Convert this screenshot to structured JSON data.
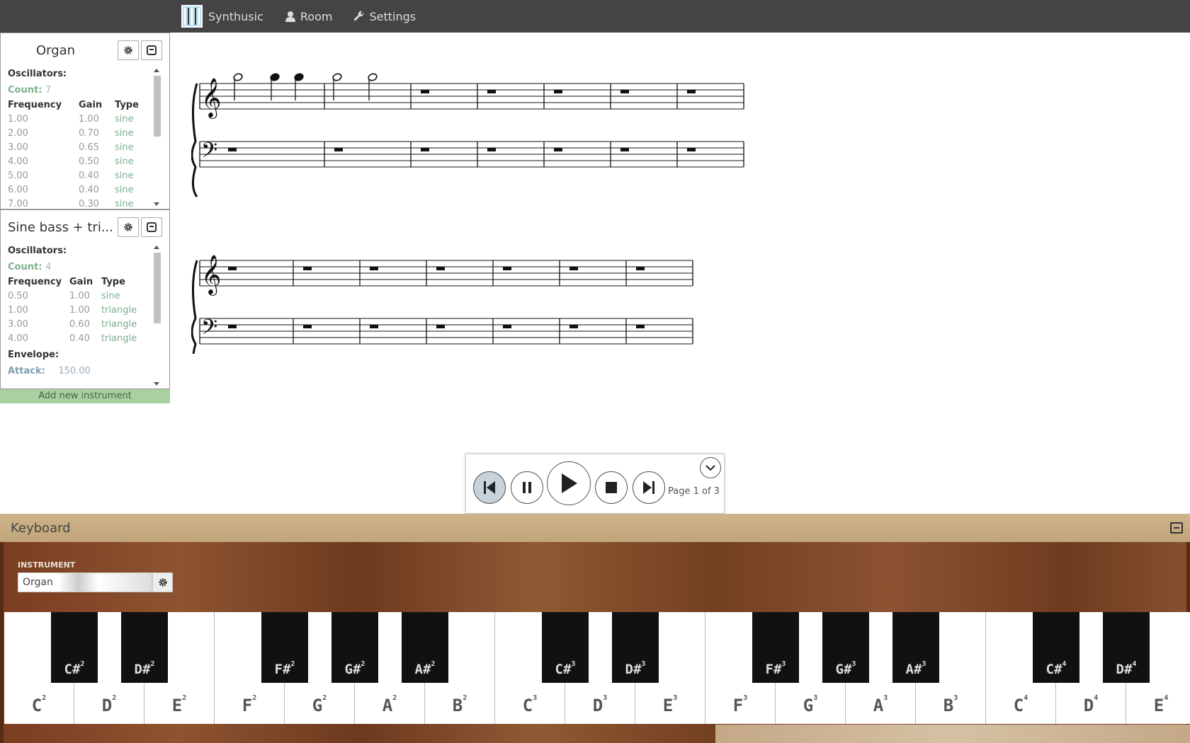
{
  "nav": {
    "brand": "Synthusic",
    "room": "Room",
    "settings": "Settings"
  },
  "instruments": [
    {
      "name": "Organ",
      "oscillators_label": "Oscillators:",
      "count_label": "Count:",
      "count": "7",
      "headers": [
        "Frequency",
        "Gain",
        "Type"
      ],
      "rows": [
        [
          "1.00",
          "1.00",
          "sine"
        ],
        [
          "2.00",
          "0.70",
          "sine"
        ],
        [
          "3.00",
          "0.65",
          "sine"
        ],
        [
          "4.00",
          "0.50",
          "sine"
        ],
        [
          "5.00",
          "0.40",
          "sine"
        ],
        [
          "6.00",
          "0.40",
          "sine"
        ],
        [
          "7.00",
          "0.30",
          "sine"
        ]
      ]
    },
    {
      "name": "Sine bass + tri...",
      "oscillators_label": "Oscillators:",
      "count_label": "Count:",
      "count": "4",
      "headers": [
        "Frequency",
        "Gain",
        "Type"
      ],
      "rows": [
        [
          "0.50",
          "1.00",
          "sine"
        ],
        [
          "1.00",
          "1.00",
          "triangle"
        ],
        [
          "3.00",
          "0.60",
          "triangle"
        ],
        [
          "4.00",
          "0.40",
          "triangle"
        ]
      ],
      "envelope_label": "Envelope:",
      "attack_label": "Attack:",
      "attack": "150.00"
    }
  ],
  "add_instrument": "Add new instrument",
  "player": {
    "page_text": "Page 1 of 3"
  },
  "keyboard": {
    "title": "Keyboard",
    "instrument_label": "INSTRUMENT",
    "instrument_value": "Organ",
    "white_keys": [
      {
        "n": "C",
        "o": "2"
      },
      {
        "n": "D",
        "o": "2"
      },
      {
        "n": "E",
        "o": "2"
      },
      {
        "n": "F",
        "o": "2"
      },
      {
        "n": "G",
        "o": "2"
      },
      {
        "n": "A",
        "o": "2"
      },
      {
        "n": "B",
        "o": "2"
      },
      {
        "n": "C",
        "o": "3"
      },
      {
        "n": "D",
        "o": "3"
      },
      {
        "n": "E",
        "o": "3"
      },
      {
        "n": "F",
        "o": "3"
      },
      {
        "n": "G",
        "o": "3"
      },
      {
        "n": "A",
        "o": "3"
      },
      {
        "n": "B",
        "o": "3"
      },
      {
        "n": "C",
        "o": "4"
      },
      {
        "n": "D",
        "o": "4"
      },
      {
        "n": "E",
        "o": "4"
      }
    ],
    "black_keys": [
      {
        "n": "C#",
        "o": "2"
      },
      {
        "n": "D#",
        "o": "2"
      },
      {
        "n": "F#",
        "o": "2"
      },
      {
        "n": "G#",
        "o": "2"
      },
      {
        "n": "A#",
        "o": "2"
      },
      {
        "n": "C#",
        "o": "3"
      },
      {
        "n": "D#",
        "o": "3"
      },
      {
        "n": "F#",
        "o": "3"
      },
      {
        "n": "G#",
        "o": "3"
      },
      {
        "n": "A#",
        "o": "3"
      },
      {
        "n": "C#",
        "o": "4"
      },
      {
        "n": "D#",
        "o": "4"
      }
    ]
  }
}
